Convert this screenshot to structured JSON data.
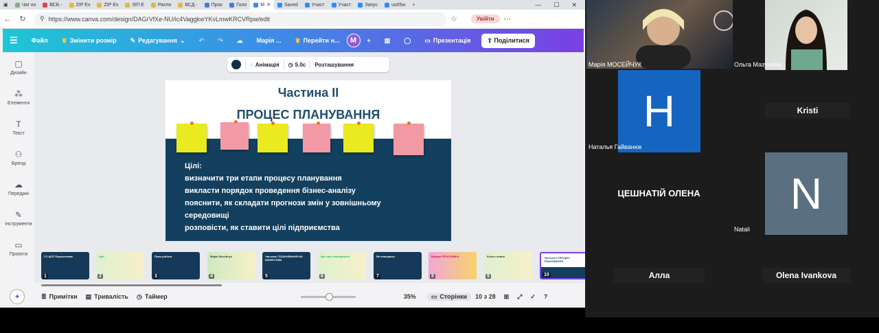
{
  "browser": {
    "tabs": [
      "Чат ко",
      "ВСБ -",
      "ZIP Ex",
      "ZIP Ex",
      "3ІП Е",
      "Распо",
      "ВСД -",
      "Проє",
      "Голо",
      "М",
      "Saved",
      "Участ",
      "Участ",
      "Запус",
      "us05w"
    ],
    "url": "https://www.canva.com/design/DAGrVfXe-NU/ic4VaggkwYKvLmwKRCVRpw/edit",
    "signin": "Увійти"
  },
  "toolbar": {
    "file": "Файл",
    "resize": "Змінити розмір",
    "edit": "Редагування",
    "owner": "Марія ...",
    "goto": "Перейти н...",
    "avatar": "M",
    "present": "Презентація",
    "share": "Поділитися"
  },
  "sidebar": [
    {
      "label": "Дизайн",
      "icon": "design-icon"
    },
    {
      "label": "Елементи",
      "icon": "elements-icon"
    },
    {
      "label": "Текст",
      "icon": "text-icon"
    },
    {
      "label": "Бренд",
      "icon": "brand-icon"
    },
    {
      "label": "Передані",
      "icon": "uploads-icon"
    },
    {
      "label": "Інструменти",
      "icon": "tools-icon"
    },
    {
      "label": "Проєкти",
      "icon": "projects-icon"
    }
  ],
  "element_toolbar": {
    "animation": "Анімація",
    "duration": "5.0с",
    "position": "Розташування"
  },
  "slide": {
    "title1": "Частина ІІ",
    "title2": "ПРОЦЕС ПЛАНУВАННЯ",
    "goals": [
      "Цілі:",
      "визначити три етапи процесу планування",
      "викласти порядок проведення бізнес-аналізу",
      "пояснити, як складати прогнози змін у зовнішньому",
      "середовищі",
      "розповісти, як ставити цілі підприємства"
    ]
  },
  "thumbnails": [
    {
      "n": "1",
      "title": "ГО ЦСП Перспектива"
    },
    {
      "n": "2",
      "title": "Цілі"
    },
    {
      "n": "3",
      "title": "План роботи"
    },
    {
      "n": "4",
      "title": "Марія Мосейчук"
    },
    {
      "n": "5",
      "title": "Частина І ПЛАНУВАННЯ НА БІЗНЕСТИВІ"
    },
    {
      "n": "6",
      "title": "Що таке планування?"
    },
    {
      "n": "7",
      "title": "Як планувати"
    },
    {
      "n": "8",
      "title": "Вправа ПРОГРАМКА"
    },
    {
      "n": "9",
      "title": "Бізнес плани"
    },
    {
      "n": "10",
      "title": "Частина ІІ ПРОЦЕС ПЛАНУВАННЯ"
    }
  ],
  "footer": {
    "notes": "Примітки",
    "duration": "Тривалість",
    "timer": "Таймер",
    "zoom": "35%",
    "pages": "Сторінки",
    "pagecount": "10 з 28"
  },
  "participants": [
    {
      "name": "Марія МОСЕЙЧУК"
    },
    {
      "name": "Ольга Мазунова"
    },
    {
      "name": "Наталья Гайванюк",
      "initial": "Н"
    },
    {
      "name": "Kristi"
    },
    {
      "name": "ЦЕШНАТІЙ ОЛЕНА"
    },
    {
      "name": "Natali",
      "initial": "N"
    },
    {
      "name": "Алла"
    },
    {
      "name": "Olena Ivankova"
    }
  ],
  "colors": {
    "avatar_blue": "#1565c0",
    "avatar_grey": "#5a7080",
    "slide_band": "#13405f",
    "note_yellow": "#e9ea1f",
    "note_pink": "#f19aa5"
  }
}
